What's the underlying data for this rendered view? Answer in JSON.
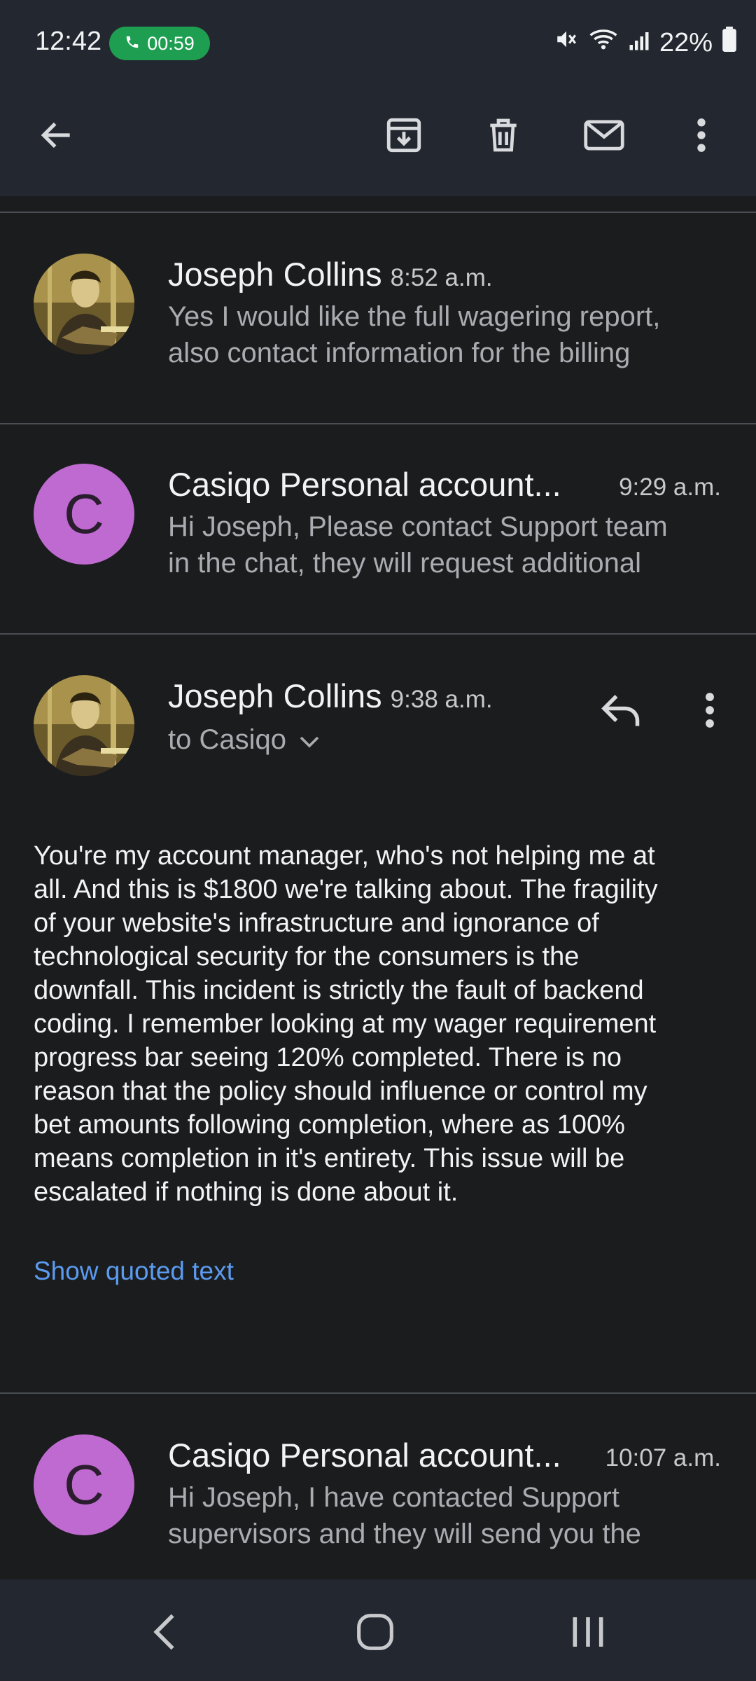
{
  "status_bar": {
    "time": "12:42",
    "call_timer": "00:59",
    "battery": "22%",
    "icons": [
      "mute-icon",
      "wifi-icon",
      "signal-icon",
      "battery-icon"
    ]
  },
  "toolbar": {
    "icons": [
      "back-arrow-icon",
      "archive-icon",
      "delete-icon",
      "mark-unread-icon",
      "more-vert-icon"
    ]
  },
  "messages": [
    {
      "sender": "Joseph Collins",
      "time": "8:52 a.m.",
      "snippet_line1": "Yes I would like the full wagering report,",
      "snippet_line2": "also contact information for the billing"
    },
    {
      "sender": "Casiqo Personal account...",
      "time": "9:29 a.m.",
      "avatar_letter": "C",
      "snippet_line1": "Hi Joseph, Please contact Support team",
      "snippet_line2": "in the chat, they will request additional"
    },
    {
      "sender": "Joseph Collins",
      "time": "9:38 a.m.",
      "recipient": "to Casiqo",
      "body": [
        "You're my account manager, who's not helping me at",
        "all. And this is $1800 we're talking about. The fragility",
        "of your website's infrastructure and ignorance of",
        "technological security for the consumers is the",
        "downfall. This incident is strictly the fault of backend",
        "coding. I remember looking at my wager requirement",
        "progress bar seeing 120% completed. There is no",
        "reason that the policy should influence or control my",
        "bet amounts following completion, where as 100%",
        "means completion in it's entirety. This issue will be",
        "escalated if nothing is done about it."
      ],
      "show_quoted": "Show quoted text"
    },
    {
      "sender": "Casiqo Personal account...",
      "time": "10:07 a.m.",
      "avatar_letter": "C",
      "snippet_line1": "Hi Joseph, I have contacted Support",
      "snippet_line2": "supervisors and they will send you the"
    }
  ],
  "colors": {
    "background": "#1b1c1e",
    "bar": "#232830",
    "avatar_c": "#bf6ad0",
    "link": "#5b9bf0",
    "call_pill": "#1e9e50"
  }
}
